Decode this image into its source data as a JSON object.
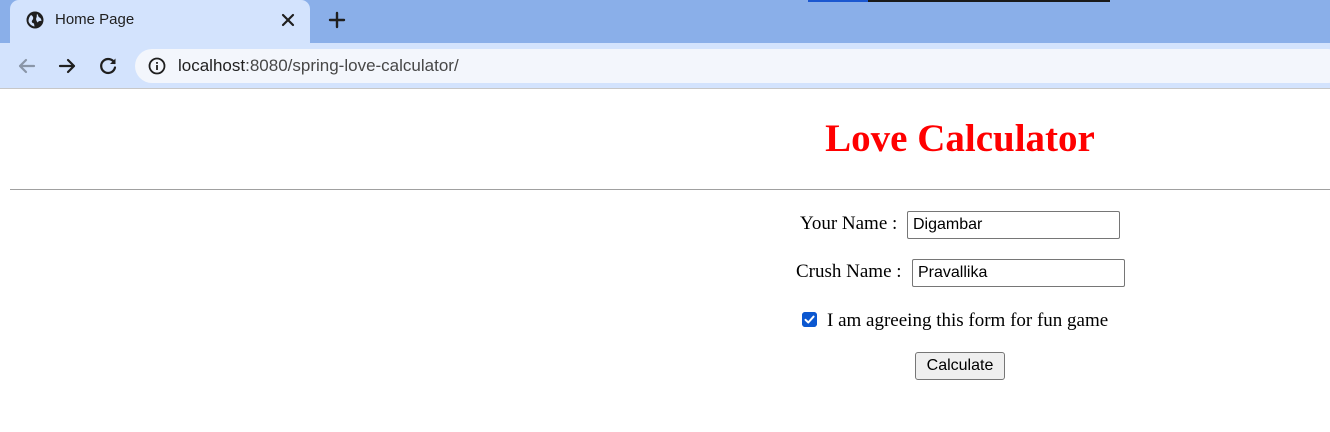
{
  "browser": {
    "tab": {
      "title": "Home Page",
      "favicon": "globe-icon",
      "close_icon": "close-icon"
    },
    "new_tab_icon": "plus-icon",
    "toolbar": {
      "back_icon": "arrow-left-icon",
      "forward_icon": "arrow-right-icon",
      "reload_icon": "reload-icon",
      "site_info_icon": "info-icon",
      "url_host": "localhost",
      "url_path": ":8080/spring-love-calculator/"
    },
    "colors": {
      "tabstrip_bg": "#8aafe9",
      "toolbar_bg": "#d3e3fd",
      "omnibox_bg": "#f3f6fc"
    }
  },
  "page": {
    "heading": "Love Calculator",
    "heading_color": "#ff0000",
    "form": {
      "your_name_label": "Your Name :",
      "your_name_value": "Digambar",
      "crush_name_label": "Crush Name :",
      "crush_name_value": "Pravallika",
      "agree_label": "I am agreeing this form for fun game",
      "agree_checked": true,
      "submit_label": "Calculate"
    }
  }
}
